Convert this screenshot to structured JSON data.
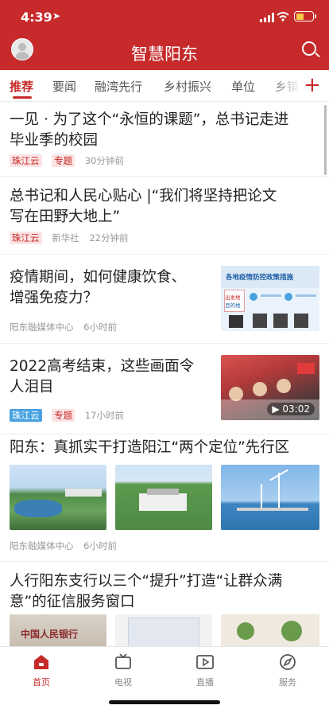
{
  "status": {
    "time": "4:39",
    "battery_level": 0.4
  },
  "app": {
    "title": "智慧阳东"
  },
  "tabs": [
    "推荐",
    "要闻",
    "融湾先行",
    "乡村振兴",
    "单位",
    "乡镇"
  ],
  "articles": [
    {
      "title_lines": [
        "一见 · 为了这个“永恒的课题”，总书记走进",
        "毕业季的校园"
      ],
      "tags": [
        "珠江云",
        "专题"
      ],
      "time": "30分钟前"
    },
    {
      "title_lines": [
        "总书记和人民心贴心 |“我们将坚持把论文",
        "写在田野大地上”"
      ],
      "tag": "珠江云",
      "source": "新华社",
      "time": "22分钟前"
    },
    {
      "title_lines": [
        "疫情期间，如何健康饮食、",
        "增强免疫力？"
      ],
      "source": "阳东融媒体中心",
      "time": "6小时前",
      "thumb": {
        "heading": "各地疫情防控政策措施",
        "left_label": "出发地",
        "left_sub": "目的地"
      }
    },
    {
      "title_lines": [
        "2022高考结束，这些画面令",
        "人泪目"
      ],
      "tags": [
        "珠江云",
        "专题"
      ],
      "time": "17小时前",
      "duration": "03:02"
    },
    {
      "title": "阳东：真抓实干打造阳江“两个定位”先行区",
      "source": "阳东融媒体中心",
      "time": "6小时前"
    },
    {
      "title_lines": [
        "人行阳东支行以三个“提升”打造“让群众满",
        "意”的征信服务窗口"
      ],
      "sign_text": "中国人民银行"
    }
  ],
  "tabbar": [
    "首页",
    "电视",
    "直播",
    "服务"
  ],
  "colors": {
    "brand": "#c62a2a",
    "link_blue": "#4aa3e0"
  }
}
